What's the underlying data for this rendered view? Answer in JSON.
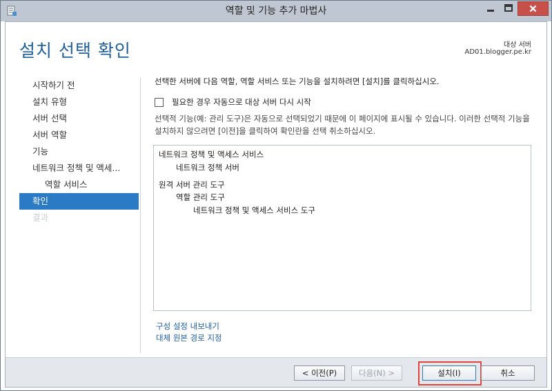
{
  "window": {
    "title": "역할 및 기능 추가 마법사",
    "controls": {
      "minimize": "minimize",
      "maximize": "maximize",
      "close": "close"
    }
  },
  "header": {
    "page_title": "설치 선택 확인",
    "destination_label": "대상 서버",
    "destination_server": "AD01.blogger.pe.kr"
  },
  "nav": {
    "items": [
      {
        "label": "시작하기 전",
        "state": "normal"
      },
      {
        "label": "설치 유형",
        "state": "normal"
      },
      {
        "label": "서버 선택",
        "state": "normal"
      },
      {
        "label": "서버 역할",
        "state": "normal"
      },
      {
        "label": "기능",
        "state": "normal"
      },
      {
        "label": "네트워크 정책 및 액세...",
        "state": "normal"
      },
      {
        "label": "역할 서비스",
        "state": "sub"
      },
      {
        "label": "확인",
        "state": "active"
      },
      {
        "label": "결과",
        "state": "disabled"
      }
    ]
  },
  "main": {
    "intro": "선택한 서버에 다음 역할, 역할 서비스 또는 기능을 설치하려면 [설치]를 클릭하십시오.",
    "restart_label": "필요한 경우 자동으로 대상 서버 다시 시작",
    "note": "선택적 기능(예: 관리 도구)은 자동으로 선택되었기 때문에 이 페이지에 표시될 수 있습니다. 이러한 선택적 기능을 설치하지 않으려면 [이전]을 클릭하여 확인란을 선택 취소하십시오.",
    "selections": [
      "네트워크 정책 및 액세스 서비스",
      "네트워크 정책 서버",
      "원격 서버 관리 도구",
      "역할 관리 도구",
      "네트워크 정책 및 액세스 서비스 도구"
    ],
    "link_export": "구성 설정 내보내기",
    "link_alt_source": "대체 원본 경로 지정"
  },
  "footer": {
    "prev": "< 이전(P)",
    "next": "다음(N) >",
    "install": "설치(I)",
    "cancel": "취소"
  },
  "colors": {
    "title_accent": "#1e5f9c",
    "nav_active": "#2b7ac6",
    "link": "#1f5fa8",
    "highlight": "#e0453d",
    "close_button": "#c7504a"
  }
}
